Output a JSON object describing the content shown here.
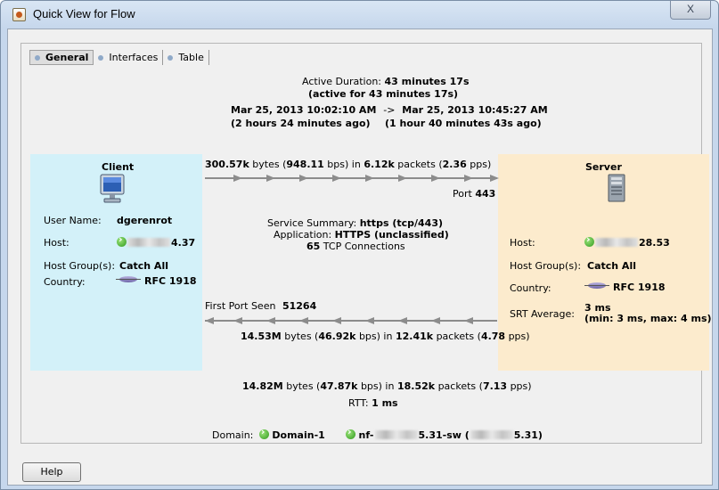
{
  "window": {
    "title": "Quick View for Flow",
    "close_glyph": "X"
  },
  "tabs": [
    {
      "label": "General",
      "active": true
    },
    {
      "label": "Interfaces",
      "active": false
    },
    {
      "label": "Table",
      "active": false
    }
  ],
  "summary": {
    "active_duration_label": "Active Duration:",
    "active_duration_value": "43 minutes 17s",
    "active_for": "(active for 43 minutes 17s)",
    "start_time": "Mar 25, 2013 10:02:10 AM",
    "arrow": "->",
    "end_time": "Mar 25, 2013 10:45:27 AM",
    "start_ago": "(2 hours 24 minutes ago)",
    "end_ago": "(1 hour 40 minutes 43s ago)"
  },
  "client": {
    "title": "Client",
    "user_name_label": "User Name:",
    "user_name": "dgerenrot",
    "host_label": "Host:",
    "host_suffix": "4.37",
    "host_groups_label": "Host Group(s):",
    "host_groups": "Catch All",
    "country_label": "Country:",
    "country": "RFC 1918"
  },
  "server": {
    "title": "Server",
    "host_label": "Host:",
    "host_suffix": "28.53",
    "host_groups_label": "Host Group(s):",
    "host_groups": "Catch All",
    "country_label": "Country:",
    "country": "RFC 1918",
    "srt_label": "SRT Average:",
    "srt_value": "3 ms",
    "srt_detail": "(min: 3 ms, max: 4 ms)"
  },
  "outbound": {
    "bytes": "300.57k",
    "bytes_text": " bytes (",
    "bps": "948.11",
    "bps_text": " bps) in ",
    "packets": "6.12k",
    "packets_text": " packets (",
    "pps": "2.36",
    "pps_text": " pps)",
    "port_label": "Port",
    "port": "443"
  },
  "service": {
    "summary_label": "Service Summary:",
    "summary_value": "https (tcp/443)",
    "application_label": "Application:",
    "application_value": "HTTPS (unclassified)",
    "connections_count": "65",
    "connections_text": " TCP Connections"
  },
  "inbound": {
    "first_port_label": "First Port Seen",
    "first_port": "51264",
    "bytes": "14.53M",
    "bytes_text": " bytes (",
    "bps": "46.92k",
    "bps_text": " bps) in ",
    "packets": "12.41k",
    "packets_text": " packets (",
    "pps": "4.78",
    "pps_text": " pps)"
  },
  "total": {
    "bytes": "14.82M",
    "bytes_text": " bytes (",
    "bps": "47.87k",
    "bps_text": " bps) in ",
    "packets": "18.52k",
    "packets_text": " packets (",
    "pps": "7.13",
    "pps_text": " pps)",
    "rtt_label": "RTT:",
    "rtt_value": "1 ms"
  },
  "domain": {
    "label": "Domain:",
    "name": "Domain-1",
    "exporter_prefix": "nf-",
    "exporter_middle": "5.31-sw (",
    "exporter_suffix": "5.31)"
  },
  "help_button": "Help"
}
